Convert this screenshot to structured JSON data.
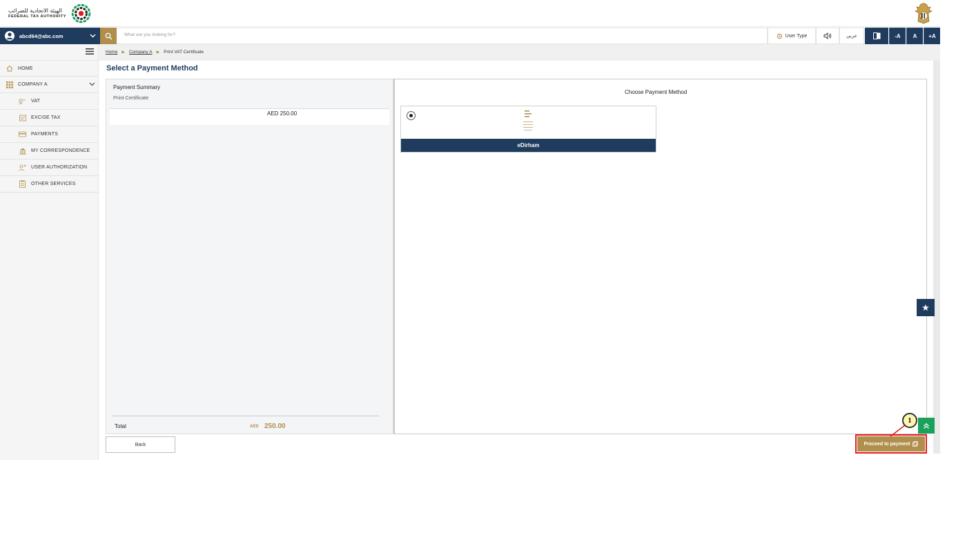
{
  "header": {
    "logo_ar": "الهيئة الاتحادية للضرائب",
    "logo_en": "FEDERAL TAX AUTHORITY"
  },
  "navbar": {
    "user_email": "abcd64@abc.com",
    "search_placeholder": "What are you looking for?",
    "user_type_label": "User Type",
    "language_label": "عربي",
    "font_decrease": "-A",
    "font_normal": "A",
    "font_increase": "+A"
  },
  "sidebar": {
    "items": [
      {
        "label": "HOME",
        "icon": "home-icon"
      },
      {
        "label": "COMPANY A",
        "icon": "grid-icon"
      },
      {
        "label": "VAT",
        "icon": "vat-icon"
      },
      {
        "label": "EXCISE TAX",
        "icon": "excise-icon"
      },
      {
        "label": "PAYMENTS",
        "icon": "payments-icon"
      },
      {
        "label": "MY CORRESPONDENCE",
        "icon": "bank-icon"
      },
      {
        "label": "USER AUTHORIZATION",
        "icon": "user-auth-icon"
      },
      {
        "label": "OTHER SERVICES",
        "icon": "services-icon"
      }
    ]
  },
  "breadcrumb": {
    "home": "Home",
    "company": "Company A",
    "current": "Print VAT Certificate"
  },
  "page": {
    "title": "Select a Payment Method"
  },
  "summary": {
    "title": "Payment Summary",
    "subtitle": "Print Certificate",
    "amount": "AED 250.00",
    "total_label": "Total",
    "total_currency": "AED",
    "total_value": "250.00"
  },
  "payment_methods": {
    "title": "Choose Payment Method",
    "options": [
      {
        "label": "eDirham",
        "selected": true
      }
    ]
  },
  "actions": {
    "back": "Back",
    "proceed": "Proceed to payment"
  },
  "annotation": {
    "callout_number": "1"
  },
  "colors": {
    "navy": "#1f3b5e",
    "gold": "#b08e4b",
    "green": "#1aa15b",
    "highlight_red": "#e01e1e"
  }
}
